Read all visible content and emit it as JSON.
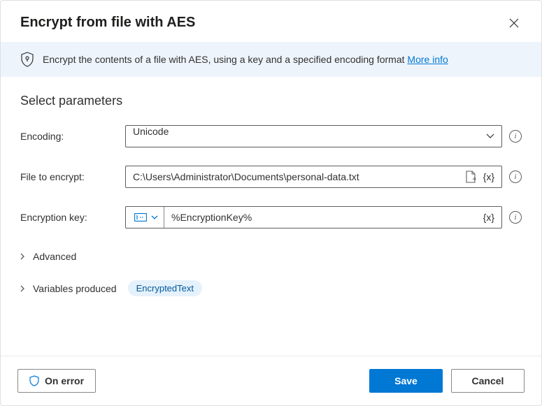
{
  "header": {
    "title": "Encrypt from file with AES"
  },
  "banner": {
    "text": "Encrypt the contents of a file with AES, using a key and a specified encoding format ",
    "link_label": "More info"
  },
  "section_title": "Select parameters",
  "params": {
    "encoding": {
      "label": "Encoding:",
      "value": "Unicode"
    },
    "file": {
      "label": "File to encrypt:",
      "value": "C:\\Users\\Administrator\\Documents\\personal-data.txt"
    },
    "key": {
      "label": "Encryption key:",
      "value": "%EncryptionKey%"
    }
  },
  "tokens": {
    "variable_glyph": "{x}"
  },
  "expanders": {
    "advanced": "Advanced",
    "variables_produced": "Variables produced",
    "variable_chip": "EncryptedText"
  },
  "footer": {
    "on_error": "On error",
    "save": "Save",
    "cancel": "Cancel"
  }
}
